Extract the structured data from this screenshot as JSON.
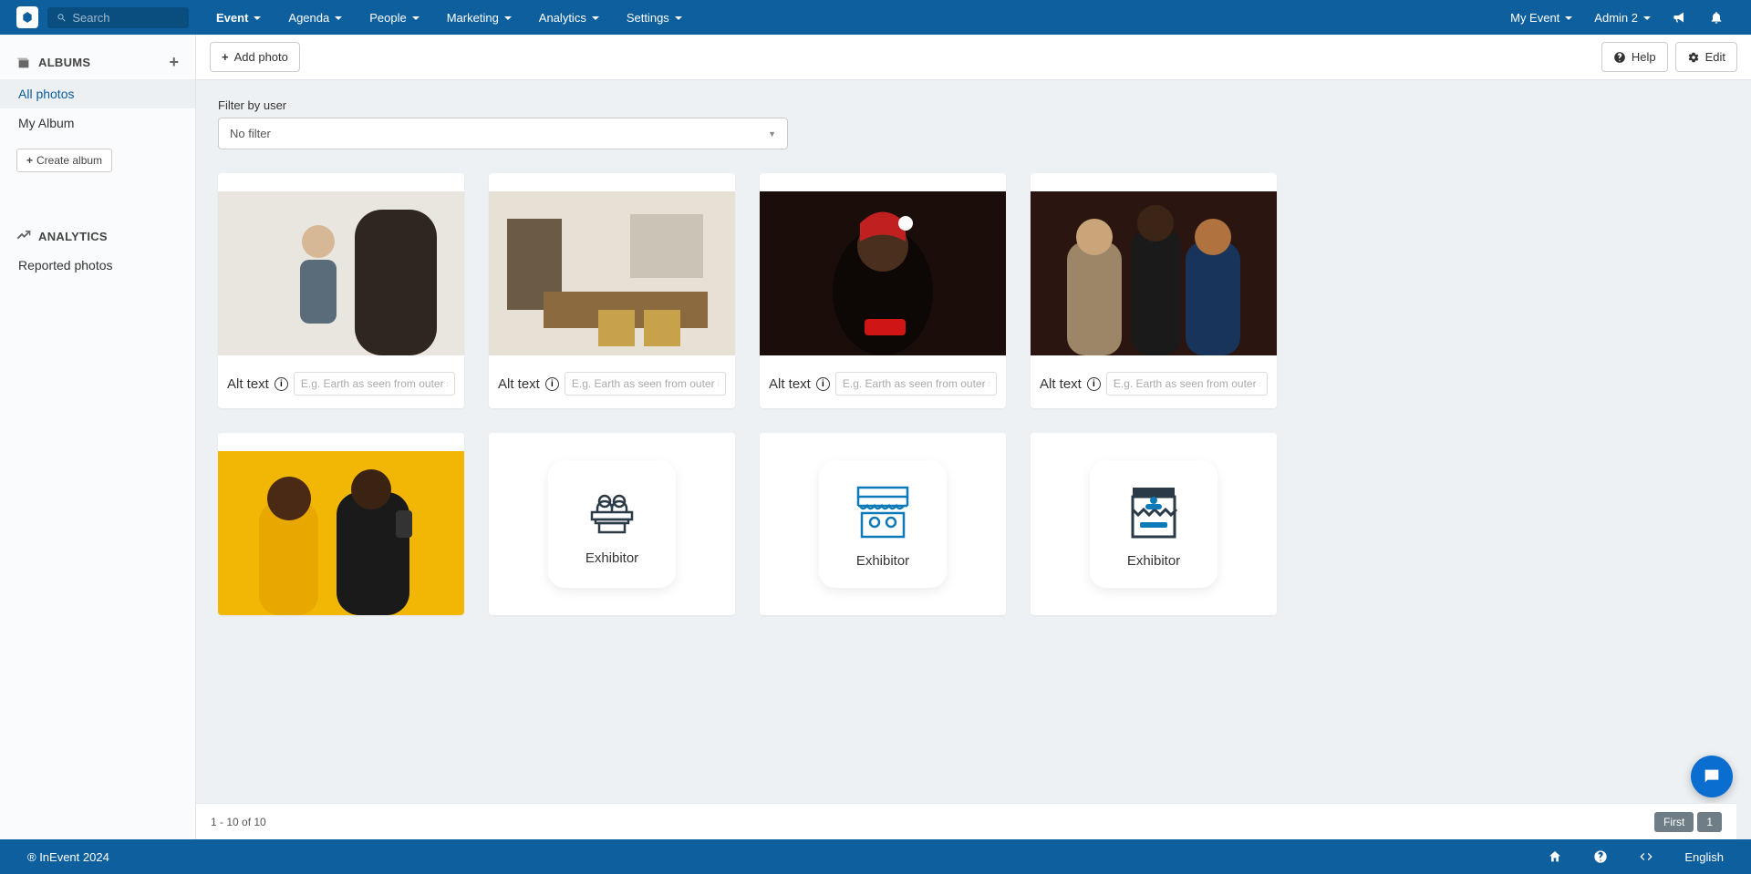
{
  "nav": {
    "search_placeholder": "Search",
    "items": [
      {
        "label": "Event",
        "active": true
      },
      {
        "label": "Agenda"
      },
      {
        "label": "People"
      },
      {
        "label": "Marketing"
      },
      {
        "label": "Analytics"
      },
      {
        "label": "Settings"
      }
    ],
    "event_switcher": "My Event",
    "user": "Admin 2"
  },
  "sidebar": {
    "albums_title": "ALBUMS",
    "items": [
      {
        "label": "All photos",
        "active": true
      },
      {
        "label": "My Album"
      }
    ],
    "create_label": "Create album",
    "analytics_title": "ANALYTICS",
    "analytics_items": [
      {
        "label": "Reported photos"
      }
    ]
  },
  "toolbar": {
    "add_photo": "Add photo",
    "help": "Help",
    "edit": "Edit"
  },
  "filter": {
    "label": "Filter by user",
    "value": "No filter"
  },
  "card": {
    "alt_label": "Alt text",
    "placeholder": "E.g. Earth as seen from outer space",
    "exhibitor": "Exhibitor"
  },
  "pagination": {
    "range": "1 - 10 of 10",
    "first": "First",
    "page": "1"
  },
  "footer": {
    "copyright": "® InEvent 2024",
    "language": "English"
  }
}
